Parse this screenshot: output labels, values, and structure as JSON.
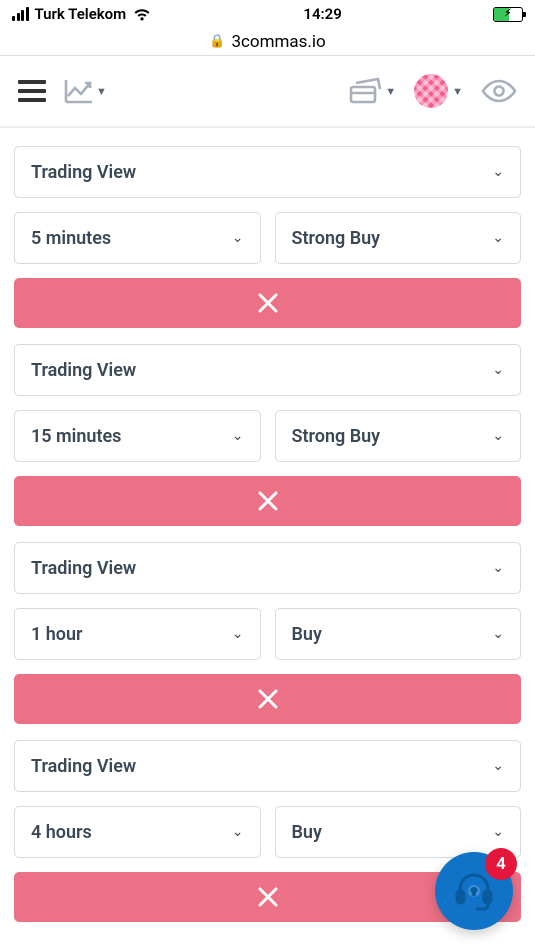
{
  "status": {
    "carrier": "Turk Telekom",
    "time": "14:29"
  },
  "url": {
    "host": "3commas.io"
  },
  "conditions": [
    {
      "source": "Trading View",
      "interval": "5 minutes",
      "signal": "Strong Buy"
    },
    {
      "source": "Trading View",
      "interval": "15 minutes",
      "signal": "Strong Buy"
    },
    {
      "source": "Trading View",
      "interval": "1 hour",
      "signal": "Buy"
    },
    {
      "source": "Trading View",
      "interval": "4 hours",
      "signal": "Buy"
    }
  ],
  "help": {
    "badge_count": "4"
  }
}
